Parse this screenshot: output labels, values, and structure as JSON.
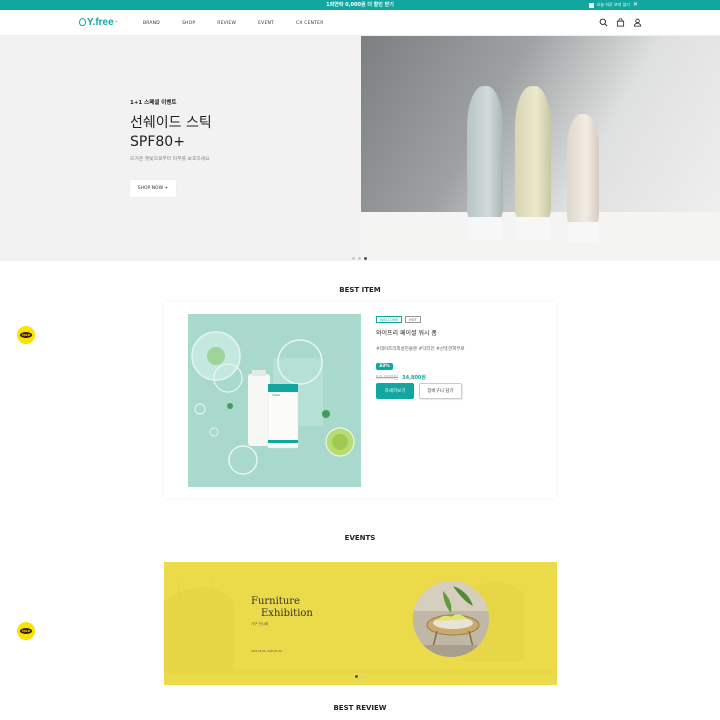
{
  "topbar": {
    "notice": "1회연락 0,000원 더 할인 받기",
    "close_label": "오늘 하루 보지 않기",
    "close_icon": "✕"
  },
  "header": {
    "logo": "Y.free",
    "logo_mark": "™",
    "nav": [
      "BRAND",
      "SHOP",
      "REVIEW",
      "EVENT",
      "CX CENTER"
    ],
    "icons": [
      "search-icon",
      "bag-icon",
      "user-icon"
    ]
  },
  "hero": {
    "subtitle": "1+1 스페셜 이벤트",
    "title_line1": "선쉐이드 스틱",
    "title_line2": "SPF80+",
    "description": "뜨거운 햇빛으로부터 피부를 보호하세요",
    "button": "SHOP NOW +",
    "slide_active": 3,
    "slide_count": 3
  },
  "best_item": {
    "section_title": "BEST ITEM",
    "tags": [
      "WELCOME",
      "HOT"
    ],
    "name": "와이프리 페이셜 워시 폼",
    "hashtags": "#데이즈리피성진클렌 #닥터인 #산뜻한피부로",
    "discount": "33%",
    "price_original": "50,000원",
    "price_sale": "34,800원",
    "detail_button": "자세히보기",
    "cart_button": "장바구니 담기",
    "product_label": "Y.free"
  },
  "events": {
    "section_title": "EVENTS",
    "banner_title_line1": "Furniture",
    "banner_title_line2": "Exhibition",
    "banner_sub": "가구 전시회",
    "banner_small": "2024.06.01~2024.06.30",
    "slide_active": 1,
    "slide_count": 2
  },
  "best_review": {
    "section_title": "BEST REVIEW"
  },
  "floating": {
    "kakao_label": "TALK"
  },
  "colors": {
    "accent": "#11a7a0",
    "event_bg": "#ebdb4a",
    "kakao": "#fbe300"
  }
}
